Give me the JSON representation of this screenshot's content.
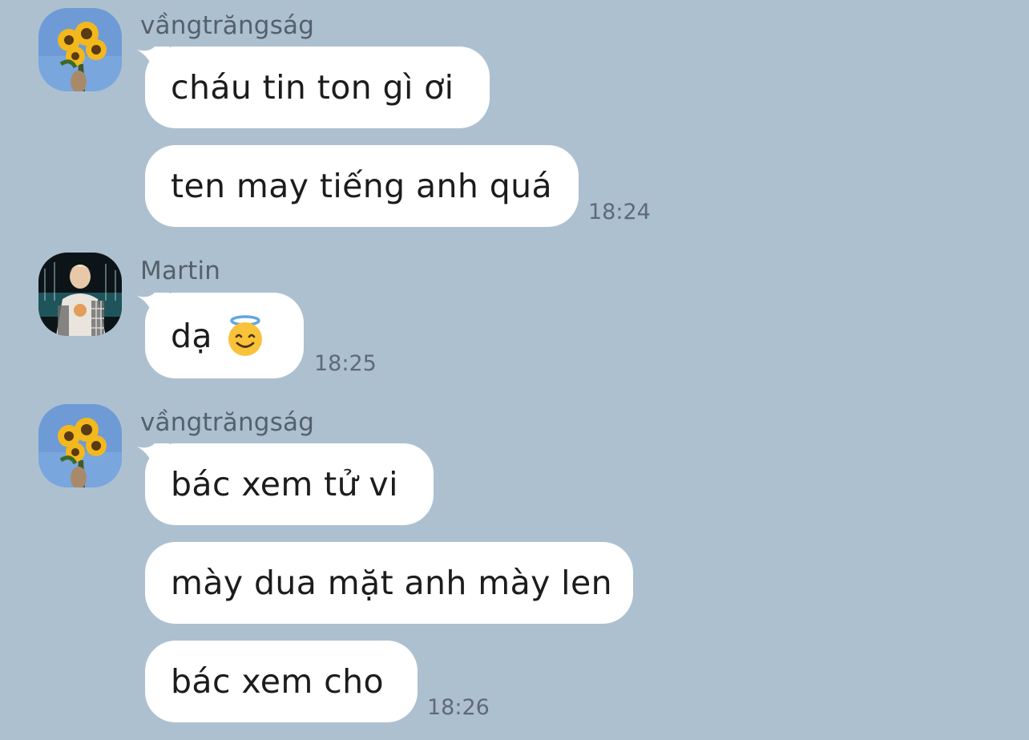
{
  "chat": {
    "groups": [
      {
        "sender": "vầngtrăngság",
        "avatar_icon": "sunflower-avatar-icon",
        "messages": [
          "cháu tin ton gì ơi",
          "ten may tiếng anh quá"
        ],
        "time": "18:24"
      },
      {
        "sender": "Martin",
        "avatar_icon": "person-photo-avatar-icon",
        "messages": [
          "dạ"
        ],
        "emoji": "smiling-face-with-halo-emoji-icon",
        "time": "18:25"
      },
      {
        "sender": "vầngtrăngság",
        "avatar_icon": "sunflower-avatar-icon",
        "messages": [
          "bác xem tử vi",
          "mày dua mặt anh mày len",
          "bác xem cho"
        ],
        "time": "18:26"
      }
    ]
  },
  "colors": {
    "background": "#adc0d0",
    "bubble": "#ffffff",
    "sender_text": "#55606b",
    "time_text": "#5f6a75"
  }
}
